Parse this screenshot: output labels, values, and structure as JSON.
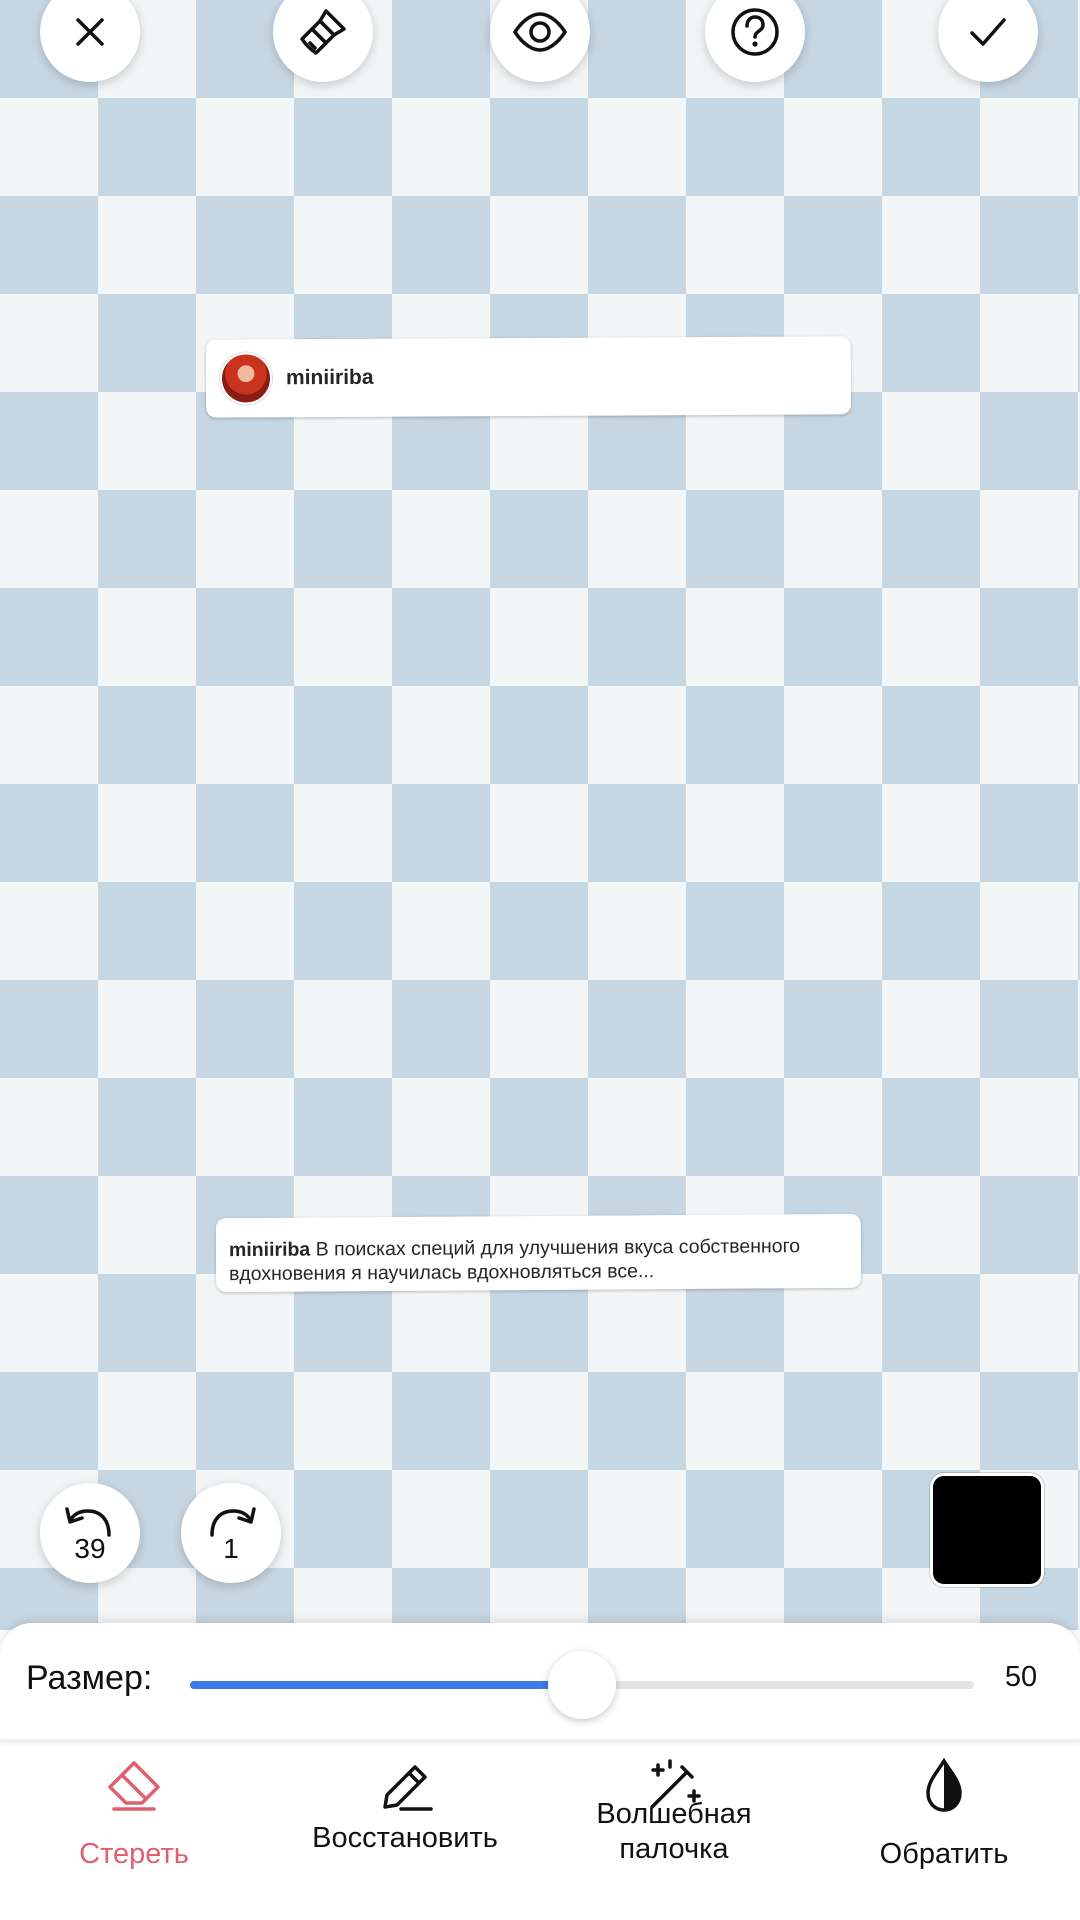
{
  "toolbar": {
    "buttons": [
      {
        "name": "close",
        "icon": "close-icon"
      },
      {
        "name": "brush",
        "icon": "brush-icon"
      },
      {
        "name": "preview",
        "icon": "eye-icon"
      },
      {
        "name": "help",
        "icon": "question-icon"
      },
      {
        "name": "done",
        "icon": "check-icon"
      }
    ]
  },
  "history": {
    "undo_count": "39",
    "redo_count": "1"
  },
  "color": {
    "selected": "#000000"
  },
  "canvas": {
    "header_fragment": {
      "username": "miniiriba"
    },
    "caption_fragment": {
      "username": "miniiriba",
      "text": "В поисках специй для улучшения вкуса собственного вдохновения я научилась вдохновляться все..."
    }
  },
  "size": {
    "label": "Размер:",
    "value": "50",
    "fraction": 0.5
  },
  "colors": {
    "accent": "#3d7ae8",
    "active_tool": "#e0606e",
    "checker_dark": "#c6d6e2",
    "checker_light": "#f2f5f6"
  },
  "tools": [
    {
      "id": "erase",
      "label": "Стереть",
      "icon": "eraser-icon",
      "active": true
    },
    {
      "id": "restore",
      "label": "Восстановить",
      "icon": "pencil-icon",
      "active": false
    },
    {
      "id": "magic",
      "label": "Волшебная палочка",
      "icon": "magic-wand-icon",
      "active": false
    },
    {
      "id": "invert",
      "label": "Обратить",
      "icon": "drop-icon",
      "active": false
    }
  ]
}
